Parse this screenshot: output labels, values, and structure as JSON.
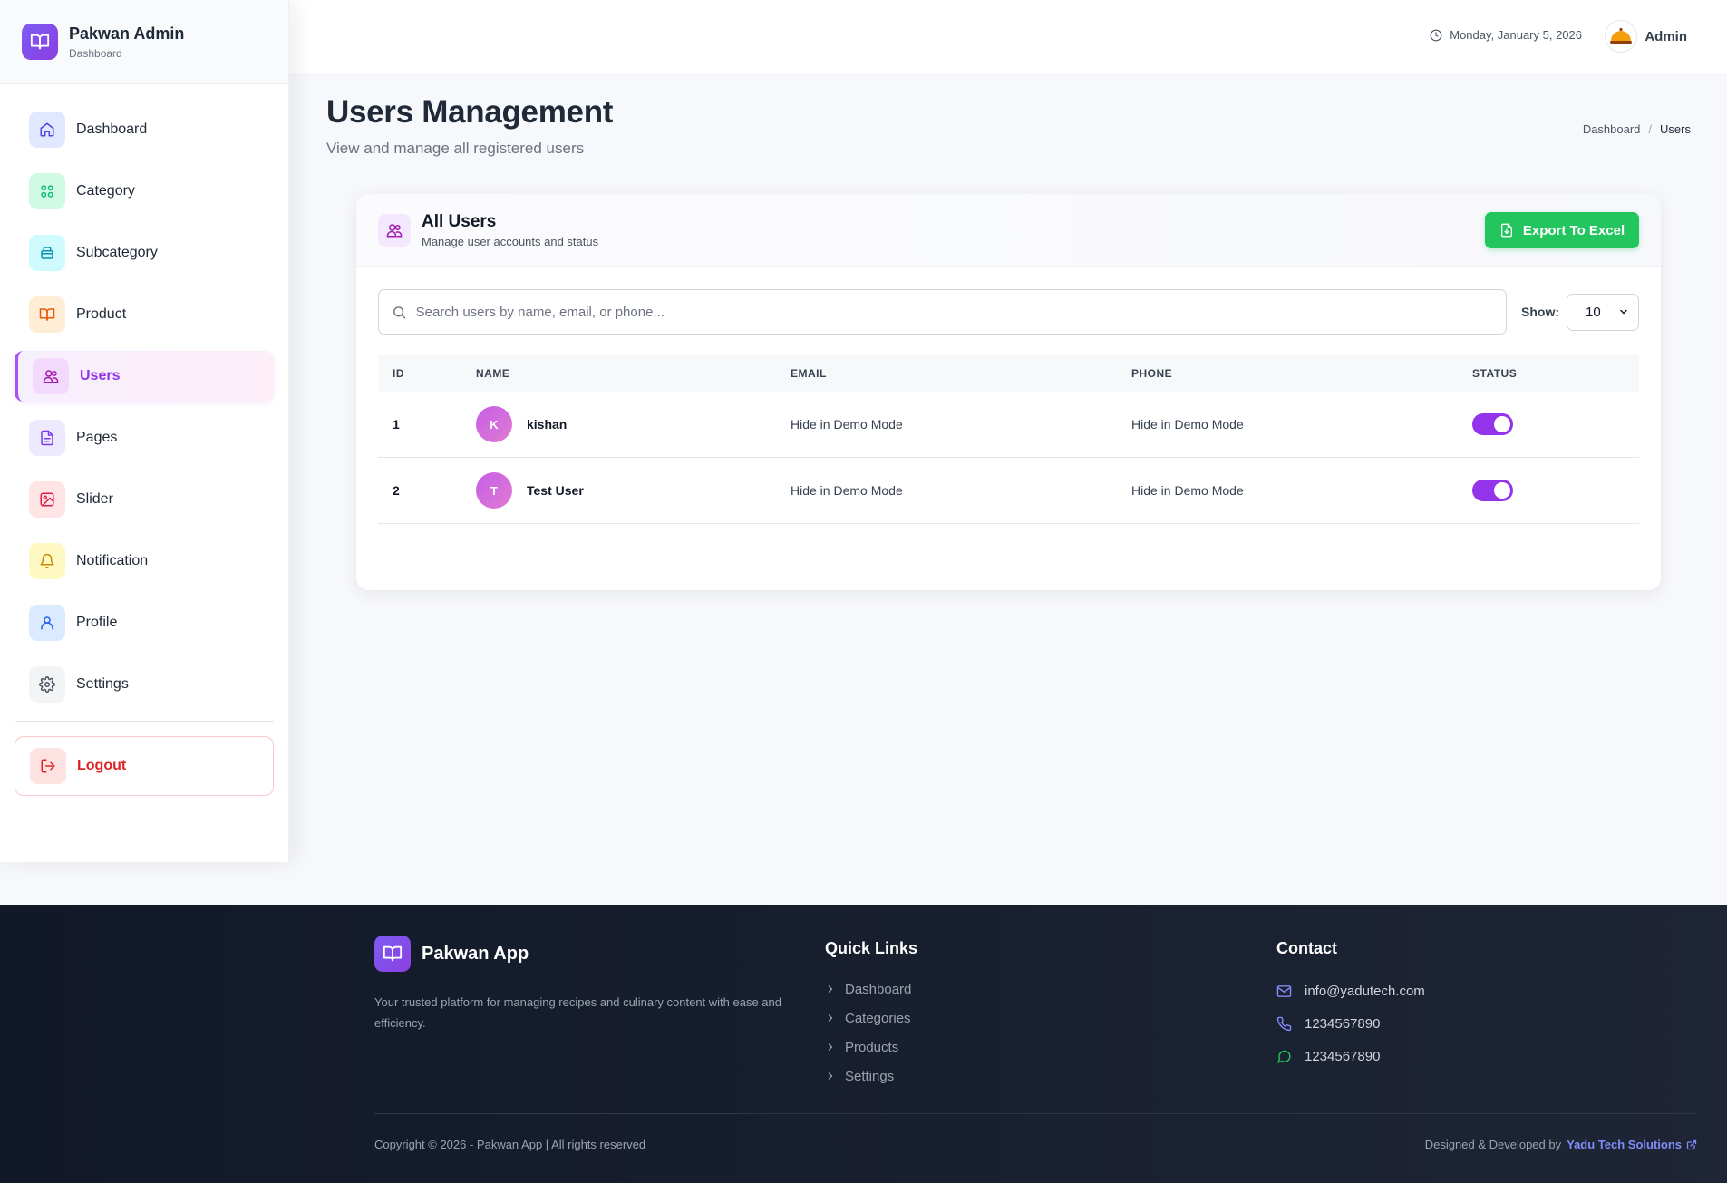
{
  "sidebar": {
    "brand_title": "Pakwan Admin",
    "brand_sub": "Dashboard",
    "items": [
      {
        "label": "Dashboard",
        "icon": "home-icon",
        "bg": "#e0e7ff",
        "color": "#4f46e5"
      },
      {
        "label": "Category",
        "icon": "grid-icon",
        "bg": "#d1fae5",
        "color": "#10b981"
      },
      {
        "label": "Subcategory",
        "icon": "layers-icon",
        "bg": "#cffafe",
        "color": "#0891b2"
      },
      {
        "label": "Product",
        "icon": "book-icon",
        "bg": "#ffedd5",
        "color": "#ea580c"
      },
      {
        "label": "Users",
        "icon": "users-icon",
        "bg": "#f3d9fb",
        "color": "#a21caf",
        "active": true
      },
      {
        "label": "Pages",
        "icon": "file-icon",
        "bg": "#ede9fe",
        "color": "#7c3aed"
      },
      {
        "label": "Slider",
        "icon": "image-icon",
        "bg": "#ffe4e6",
        "color": "#e11d48"
      },
      {
        "label": "Notification",
        "icon": "bell-icon",
        "bg": "#fef9c3",
        "color": "#ca8a04"
      },
      {
        "label": "Profile",
        "icon": "user-icon",
        "bg": "#dbeafe",
        "color": "#2563eb"
      },
      {
        "label": "Settings",
        "icon": "gear-icon",
        "bg": "#f3f4f6",
        "color": "#4b5563"
      }
    ],
    "logout_label": "Logout"
  },
  "header": {
    "date": "Monday, January 5, 2026",
    "user_name": "Admin"
  },
  "page": {
    "title": "Users Management",
    "subtitle": "View and manage all registered users",
    "breadcrumb": [
      "Dashboard",
      "Users"
    ]
  },
  "card": {
    "title": "All Users",
    "subtitle": "Manage user accounts and status",
    "export_label": "Export To Excel",
    "search_placeholder": "Search users by name, email, or phone...",
    "show_label": "Show:",
    "show_value": "10",
    "columns": [
      "ID",
      "NAME",
      "EMAIL",
      "PHONE",
      "STATUS"
    ],
    "rows": [
      {
        "id": "1",
        "initial": "K",
        "name": "kishan",
        "email": "Hide in Demo Mode",
        "phone": "Hide in Demo Mode",
        "active": true
      },
      {
        "id": "2",
        "initial": "T",
        "name": "Test User",
        "email": "Hide in Demo Mode",
        "phone": "Hide in Demo Mode",
        "active": true
      }
    ]
  },
  "footer": {
    "brand": "Pakwan App",
    "description": "Your trusted platform for managing recipes and culinary content with ease and efficiency.",
    "quick_links_title": "Quick Links",
    "quick_links": [
      "Dashboard",
      "Categories",
      "Products",
      "Settings"
    ],
    "contact_title": "Contact",
    "email": "info@yadutech.com",
    "phone": "1234567890",
    "whatsapp": "1234567890",
    "copyright": "Copyright © 2026 - Pakwan App | All rights reserved",
    "credit_prefix": "Designed & Developed by",
    "credit_name": "Yadu Tech Solutions"
  },
  "colors": {
    "accent": "#9333ea",
    "success": "#22c55e",
    "footer_bg": "#111827"
  }
}
